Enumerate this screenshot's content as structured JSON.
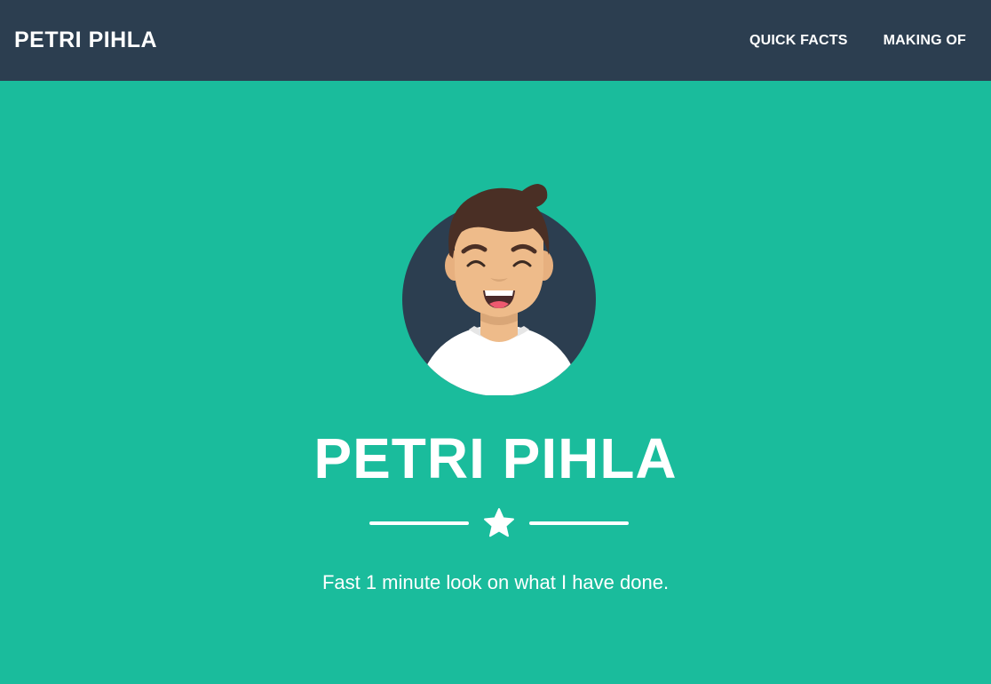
{
  "navbar": {
    "brand": "PETRI PIHLA",
    "links": [
      {
        "label": "QUICK FACTS"
      },
      {
        "label": "MAKING OF"
      }
    ]
  },
  "hero": {
    "title": "PETRI PIHLA",
    "subtitle": "Fast 1 minute look on what I have done.",
    "divider_icon": "star-icon",
    "avatar_icon": "smiling-man-avatar"
  },
  "colors": {
    "navbar_bg": "#2c3e50",
    "hero_bg": "#1abc9c",
    "text": "#ffffff"
  }
}
